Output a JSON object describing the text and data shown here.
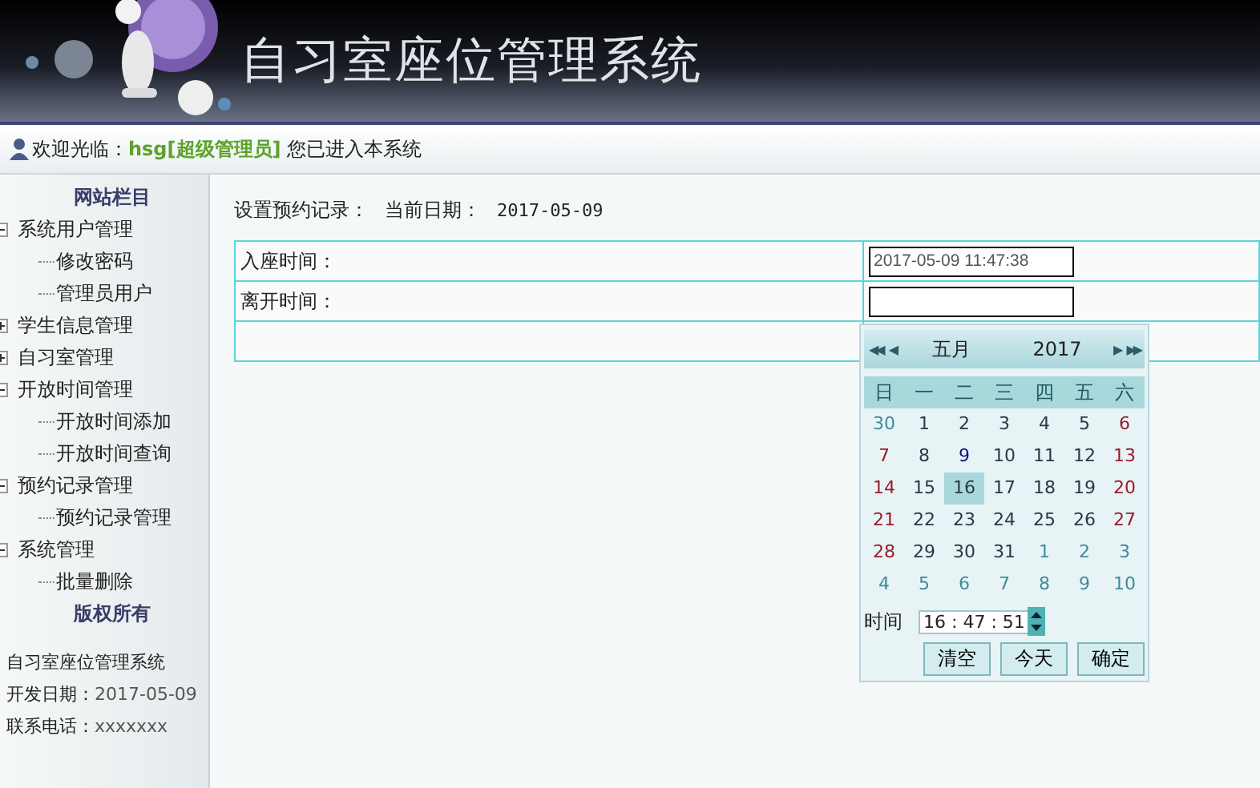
{
  "header": {
    "title": "自习室座位管理系统"
  },
  "welcome": {
    "prefix": "欢迎光临：",
    "user": "hsg[超级管理员]",
    "suffix": "您已进入本系统"
  },
  "sidebar": {
    "heading": "网站栏目",
    "items": [
      {
        "label": "系统用户管理",
        "expanded": true,
        "children": [
          {
            "label": "修改密码"
          },
          {
            "label": "管理员用户"
          }
        ]
      },
      {
        "label": "学生信息管理",
        "expanded": false
      },
      {
        "label": "自习室管理",
        "expanded": false
      },
      {
        "label": "开放时间管理",
        "expanded": true,
        "children": [
          {
            "label": "开放时间添加"
          },
          {
            "label": "开放时间查询"
          }
        ]
      },
      {
        "label": "预约记录管理",
        "expanded": true,
        "children": [
          {
            "label": "预约记录管理"
          }
        ]
      },
      {
        "label": "系统管理",
        "expanded": true,
        "children": [
          {
            "label": "批量删除"
          }
        ]
      }
    ],
    "copyright_heading": "版权所有",
    "info": [
      {
        "label": "自习室座位管理系统"
      },
      {
        "label": "开发日期：",
        "value": "2017-05-09"
      },
      {
        "label": "联系电话：",
        "value": "xxxxxxx"
      }
    ]
  },
  "content": {
    "heading": "设置预约记录：",
    "date_label": "当前日期：",
    "date": "2017-05-09",
    "form": [
      {
        "label": "入座时间：",
        "value": "2017-05-09 11:47:38"
      },
      {
        "label": "离开时间："
      }
    ]
  },
  "calendar": {
    "month": "五月",
    "year": "2017",
    "prev_year": "◀◀",
    "prev_month": "◀",
    "next_month": "▶",
    "next_year": "▶▶",
    "weekdays": [
      "日",
      "一",
      "二",
      "三",
      "四",
      "五",
      "六"
    ],
    "days": [
      {
        "label": "30",
        "kind": "other",
        "selected": false,
        "today": false
      },
      {
        "label": "1",
        "kind": "current",
        "selected": false,
        "today": false
      },
      {
        "label": "2",
        "kind": "current",
        "selected": false,
        "today": false
      },
      {
        "label": "3",
        "kind": "current",
        "selected": false,
        "today": false
      },
      {
        "label": "4",
        "kind": "current",
        "selected": false,
        "today": false
      },
      {
        "label": "5",
        "kind": "current",
        "selected": false,
        "today": false
      },
      {
        "label": "6",
        "kind": "current",
        "selected": false,
        "today": false
      },
      {
        "label": "7",
        "kind": "current",
        "selected": false,
        "today": false
      },
      {
        "label": "8",
        "kind": "current",
        "selected": false,
        "today": false
      },
      {
        "label": "9",
        "kind": "current",
        "selected": false,
        "today": true
      },
      {
        "label": "10",
        "kind": "current",
        "selected": false,
        "today": false
      },
      {
        "label": "11",
        "kind": "current",
        "selected": false,
        "today": false
      },
      {
        "label": "12",
        "kind": "current",
        "selected": false,
        "today": false
      },
      {
        "label": "13",
        "kind": "current",
        "selected": false,
        "today": false
      },
      {
        "label": "14",
        "kind": "current",
        "selected": false,
        "today": false
      },
      {
        "label": "15",
        "kind": "current",
        "selected": false,
        "today": false
      },
      {
        "label": "16",
        "kind": "current",
        "selected": true,
        "today": false
      },
      {
        "label": "17",
        "kind": "current",
        "selected": false,
        "today": false
      },
      {
        "label": "18",
        "kind": "current",
        "selected": false,
        "today": false
      },
      {
        "label": "19",
        "kind": "current",
        "selected": false,
        "today": false
      },
      {
        "label": "20",
        "kind": "current",
        "selected": false,
        "today": false
      },
      {
        "label": "21",
        "kind": "current",
        "selected": false,
        "today": false
      },
      {
        "label": "22",
        "kind": "current",
        "selected": false,
        "today": false
      },
      {
        "label": "23",
        "kind": "current",
        "selected": false,
        "today": false
      },
      {
        "label": "24",
        "kind": "current",
        "selected": false,
        "today": false
      },
      {
        "label": "25",
        "kind": "current",
        "selected": false,
        "today": false
      },
      {
        "label": "26",
        "kind": "current",
        "selected": false,
        "today": false
      },
      {
        "label": "27",
        "kind": "current",
        "selected": false,
        "today": false
      },
      {
        "label": "28",
        "kind": "current",
        "selected": false,
        "today": false
      },
      {
        "label": "29",
        "kind": "current",
        "selected": false,
        "today": false
      },
      {
        "label": "30",
        "kind": "current",
        "selected": false,
        "today": false
      },
      {
        "label": "31",
        "kind": "current",
        "selected": false,
        "today": false
      },
      {
        "label": "1",
        "kind": "other",
        "selected": false,
        "today": false
      },
      {
        "label": "2",
        "kind": "other",
        "selected": false,
        "today": false
      },
      {
        "label": "3",
        "kind": "other",
        "selected": false,
        "today": false
      },
      {
        "label": "4",
        "kind": "other",
        "selected": false,
        "today": false
      },
      {
        "label": "5",
        "kind": "other",
        "selected": false,
        "today": false
      },
      {
        "label": "6",
        "kind": "other",
        "selected": false,
        "today": false
      },
      {
        "label": "7",
        "kind": "other",
        "selected": false,
        "today": false
      },
      {
        "label": "8",
        "kind": "other",
        "selected": false,
        "today": false
      },
      {
        "label": "9",
        "kind": "other",
        "selected": false,
        "today": false
      },
      {
        "label": "10",
        "kind": "other",
        "selected": false,
        "today": false
      }
    ],
    "time_label": "时间",
    "time": "16 : 47 : 51",
    "buttons": [
      "清空",
      "今天",
      "确定"
    ]
  }
}
